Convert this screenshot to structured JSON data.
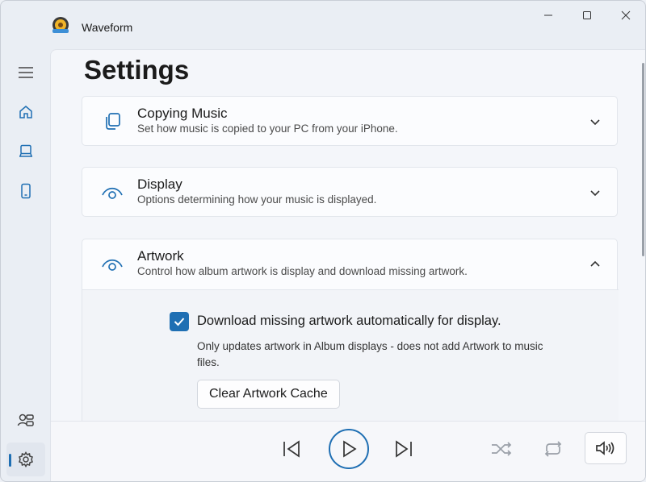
{
  "window": {
    "app_title": "Waveform"
  },
  "settings": {
    "page_title": "Settings",
    "sections": [
      {
        "title": "Copying Music",
        "description": "Set how music is copied to your PC from your iPhone.",
        "icon": "copy-icon",
        "expanded": false
      },
      {
        "title": "Display",
        "description": "Options determining how your music is displayed.",
        "icon": "eye-icon",
        "expanded": false
      },
      {
        "title": "Artwork",
        "description": "Control how album artwork is display and download missing artwork.",
        "icon": "eye-icon",
        "expanded": true
      }
    ],
    "artwork": {
      "download_label": "Download missing artwork automatically for display.",
      "download_checked": true,
      "download_note": "Only updates artwork in Album displays - does not add Artwork to music files.",
      "clear_cache_label": "Clear Artwork Cache"
    }
  },
  "colors": {
    "accent": "#1f6fb3",
    "background": "#eaeef4",
    "card": "#fbfcfe"
  }
}
